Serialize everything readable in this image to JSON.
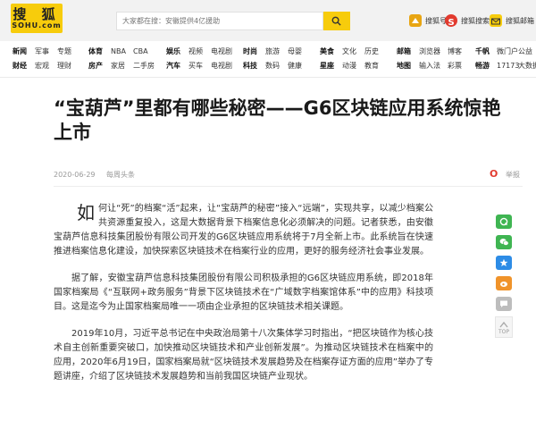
{
  "header": {
    "logo_cn": "搜 狐",
    "logo_en": "SOHU.com",
    "search_placeholder": "大家都在搜：安徽提供4亿援助",
    "apps": [
      {
        "label": "搜狐号",
        "icon": "sohu-hao-icon",
        "color": "#e8a512"
      },
      {
        "label": "搜狐搜索",
        "icon": "sohu-search-icon",
        "color": "#e23a2e"
      },
      {
        "label": "搜狐邮箱",
        "icon": "sohu-mail-icon",
        "color": "#f7cc0c"
      }
    ]
  },
  "channels": {
    "g1": [
      "新闻",
      "军事",
      "专题",
      "财经",
      "宏观",
      "理财"
    ],
    "g2": [
      "体育",
      "NBA",
      "CBA",
      "房产",
      "家居",
      "二手房"
    ],
    "g3": [
      "娱乐",
      "视频",
      "电视剧",
      "汽车",
      "买车",
      "电视剧"
    ],
    "g4": [
      "时尚",
      "旅游",
      "母婴",
      "科技",
      "数码",
      "健康"
    ],
    "g5": [
      "美食",
      "文化",
      "历史",
      "星座",
      "动漫",
      "教育"
    ],
    "g6": [
      "邮箱",
      "浏览器",
      "博客",
      "地图",
      "输入法",
      "彩票"
    ],
    "g7": [
      "千帆",
      "微门户",
      "公益",
      "畅游",
      "17173",
      "大数据"
    ]
  },
  "article": {
    "title": "“宝葫芦”里都有哪些秘密——G6区块链应用系统惊艳上市",
    "date": "2020-06-29",
    "author": "每周头条",
    "report": "举报",
    "dropcap": "如",
    "paragraphs": [
      "何让“死”的档案“活”起来，让“宝葫芦的秘密”接入“远端”，实现共享，以减少档案公共资源重复投入，这是大数据背景下档案信息化必须解决的问题。记者获悉，由安徽宝葫芦信息科技集团股份有限公司开发的G6区块链应用系统将于7月全新上市。此系统旨在快速推进档案信息化建设，加快探索区块链技术在档案行业的应用，更好的服务经济社会事业发展。",
      "据了解，安徽宝葫芦信息科技集团股份有限公司积极承担的G6区块链应用系统，即2018年国家档案局《“互联网+政务服务”背景下区块链技术在“广域数字档案馆体系”中的应用》科技项目。这是迄今为止国家档案局唯一一项由企业承担的区块链技术相关课题。",
      "2019年10月，习近平总书记在中央政治局第十八次集体学习时指出，“把区块链作为核心技术自主创新重要突破口，加快推动区块链技术和产业创新发展”。为推动区块链技术在档案中的应用，2020年6月19日，国家档案局就“区块链技术发展趋势及在档案存证方面的应用”举办了专题讲座，介绍了区块链技术发展趋势和当前我国区块链产业现状。"
    ]
  },
  "share": {
    "buttons": [
      {
        "icon": "qq-zone-icon",
        "color": "#3fb552"
      },
      {
        "icon": "wechat-icon",
        "color": "#3fb552"
      },
      {
        "icon": "star-icon",
        "color": "#2d8ce6"
      },
      {
        "icon": "weibo-icon",
        "color": "#f0932a"
      },
      {
        "icon": "comment-icon",
        "color": "#bdbdbd"
      }
    ],
    "top_label": "TOP"
  }
}
